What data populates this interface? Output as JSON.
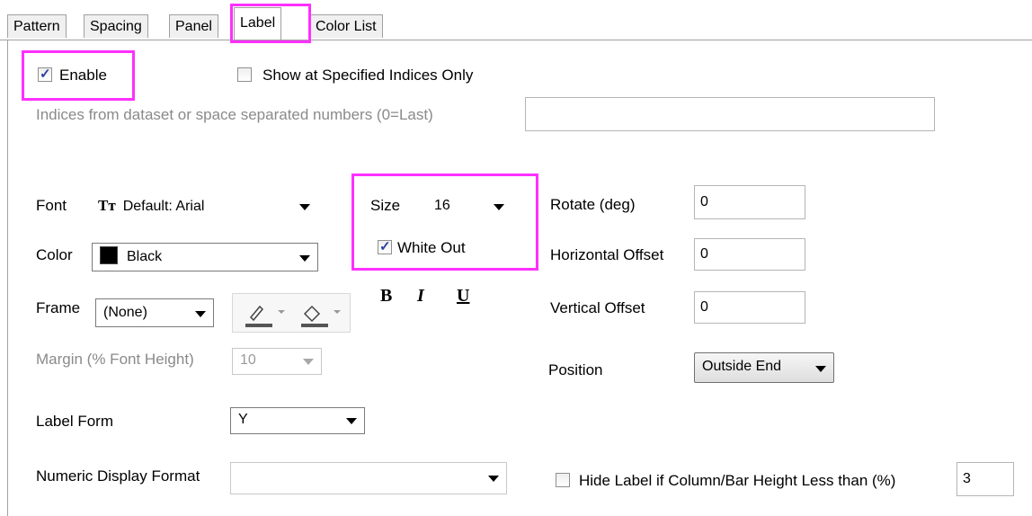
{
  "tabs": [
    "Pattern",
    "Spacing",
    "Panel",
    "Label",
    "Color List"
  ],
  "enable": {
    "label": "Enable",
    "checked": true
  },
  "show_specified": {
    "label": "Show at Specified Indices Only",
    "checked": false
  },
  "indices": {
    "label": "Indices from dataset or space separated numbers (0=Last)",
    "value": ""
  },
  "font": {
    "label": "Font",
    "icon": "font-icon",
    "value": "Default: Arial"
  },
  "color": {
    "label": "Color",
    "value": "Black",
    "swatch": "#000000"
  },
  "frame": {
    "label": "Frame",
    "value": "(None)"
  },
  "margin": {
    "label": "Margin (% Font Height)",
    "value": "10"
  },
  "label_form": {
    "label": "Label Form",
    "value": "Y"
  },
  "numeric_format": {
    "label": "Numeric Display Format",
    "value": ""
  },
  "size": {
    "label": "Size",
    "value": "16"
  },
  "white_out": {
    "label": "White Out",
    "checked": true
  },
  "format_buttons": {
    "bold": "B",
    "italic": "I",
    "underline": "U"
  },
  "rotate": {
    "label": "Rotate (deg)",
    "value": "0"
  },
  "h_offset": {
    "label": "Horizontal Offset",
    "value": "0"
  },
  "v_offset": {
    "label": "Vertical Offset",
    "value": "0"
  },
  "position": {
    "label": "Position",
    "value": "Outside End"
  },
  "hide_label": {
    "label": "Hide Label if Column/Bar Height Less than (%)",
    "checked": false,
    "value": "3"
  },
  "highlight_color": "#ff30ff"
}
